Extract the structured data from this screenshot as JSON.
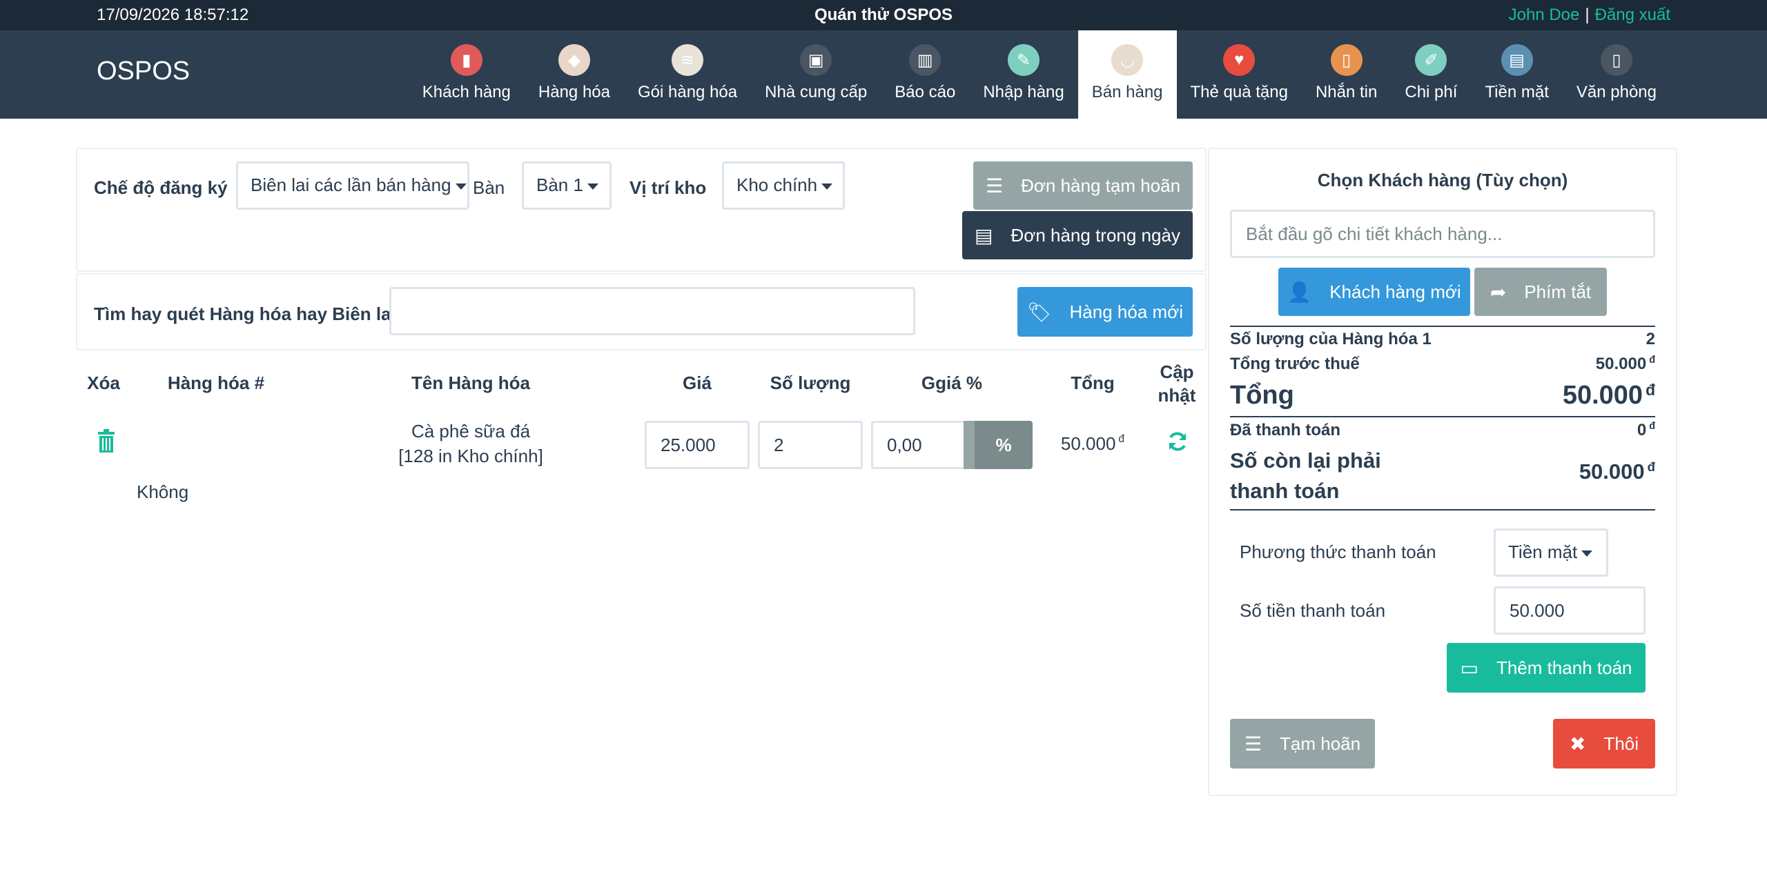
{
  "topbar": {
    "datetime": "17/09/2026 18:57:12",
    "shop_name": "Quán thử OSPOS",
    "user": "John Doe",
    "separator": "|",
    "logout": "Đăng xuất"
  },
  "brand": "OSPOS",
  "nav": [
    {
      "label": "Khách hàng",
      "icon": "address-book-icon",
      "color": "#e05a5a",
      "active": false
    },
    {
      "label": "Hàng hóa",
      "icon": "tag-icon",
      "color": "#e8d7c8",
      "active": false
    },
    {
      "label": "Gói hàng hóa",
      "icon": "layers-icon",
      "color": "#e8e2d8",
      "active": false
    },
    {
      "label": "Nhà cung cấp",
      "icon": "briefcase-icon",
      "color": "#4a5663",
      "active": false
    },
    {
      "label": "Báo cáo",
      "icon": "bar-chart-icon",
      "color": "#4a5663",
      "active": false
    },
    {
      "label": "Nhập hàng",
      "icon": "pencil-icon",
      "color": "#7fcfc0",
      "active": false
    },
    {
      "label": "Bán hàng",
      "icon": "basket-icon",
      "color": "#e8dccf",
      "active": true
    },
    {
      "label": "Thẻ quà tặng",
      "icon": "heart-icon",
      "color": "#e74c3c",
      "active": false
    },
    {
      "label": "Nhắn tin",
      "icon": "phone-icon",
      "color": "#e8924f",
      "active": false
    },
    {
      "label": "Chi phí",
      "icon": "note-icon",
      "color": "#7fcfc0",
      "active": false
    },
    {
      "label": "Tiền mặt",
      "icon": "books-icon",
      "color": "#5d8fb3",
      "active": false
    },
    {
      "label": "Văn phòng",
      "icon": "door-icon",
      "color": "#4a5663",
      "active": false
    }
  ],
  "register": {
    "mode_label": "Chế độ đăng ký",
    "mode_value": "Biên lai các lần bán hàng",
    "table_label": "Bàn",
    "table_value": "Bàn 1",
    "stock_label": "Vị trí kho",
    "stock_value": "Kho chính",
    "suspended_button": "Đơn hàng tạm hoãn",
    "daily_button": "Đơn hàng trong ngày"
  },
  "search": {
    "label": "Tìm hay quét Hàng hóa hay Biên lai",
    "value": "",
    "new_item_button": "Hàng hóa mới"
  },
  "cart": {
    "headers": {
      "delete": "Xóa",
      "item_number": "Hàng hóa #",
      "item_name": "Tên Hàng hóa",
      "price": "Giá",
      "quantity": "Số lượng",
      "discount": "Ggiá %",
      "total": "Tổng",
      "update": "Cập nhật"
    },
    "rows": [
      {
        "item_number": "",
        "name": "Cà phê sữa đá",
        "stock": "[128 in Kho chính]",
        "price": "25.000",
        "quantity": "2",
        "discount": "0,00",
        "discount_toggle": "%",
        "total": "50.000",
        "currency": "đ",
        "description": "Không"
      }
    ]
  },
  "customer": {
    "title": "Chọn Khách hàng (Tùy chọn)",
    "placeholder": "Bắt đầu gõ chi tiết khách hàng...",
    "new_customer_button": "Khách hàng mới",
    "shortcut_button": "Phím tắt"
  },
  "summary": {
    "qty_label": "Số lượng của Hàng hóa 1",
    "qty_value": "2",
    "subtotal_label": "Tổng trước thuế",
    "subtotal_value": "50.000",
    "total_label": "Tổng",
    "total_value": "50.000",
    "paid_label": "Đã thanh toán",
    "paid_value": "0",
    "due_label": "Số còn lại phải thanh toán",
    "due_value": "50.000",
    "currency": "đ"
  },
  "payment": {
    "method_label": "Phương thức thanh toán",
    "method_value": "Tiền mặt",
    "amount_label": "Số tiền thanh toán",
    "amount_value": "50.000",
    "add_payment_button": "Thêm thanh toán",
    "suspend_button": "Tạm hoãn",
    "cancel_button": "Thôi"
  },
  "colors": {
    "navbar": "#2c3e50",
    "topbar": "#1c2936",
    "accent_teal": "#18bc9c",
    "accent_blue": "#3498db",
    "danger": "#e74c3c",
    "muted": "#95a5a6"
  }
}
